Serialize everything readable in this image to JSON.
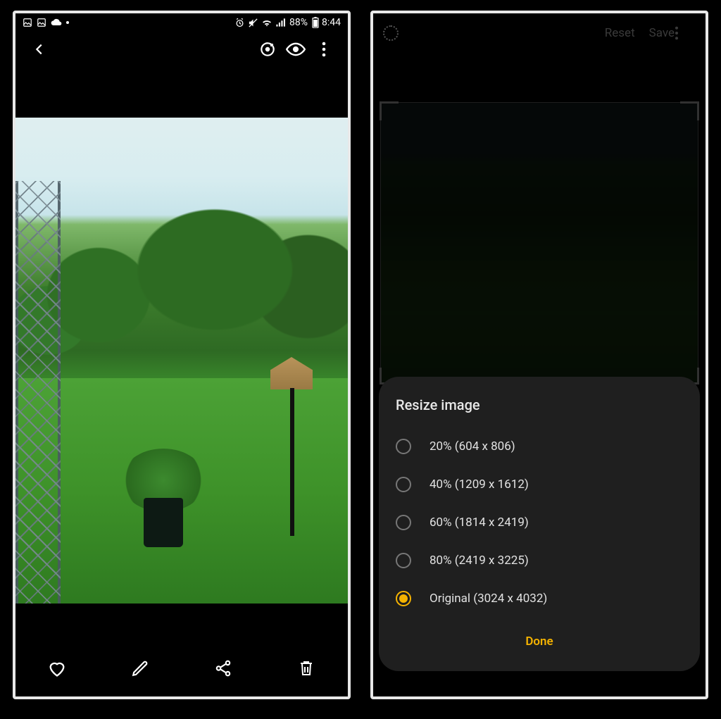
{
  "status": {
    "icons_left": [
      "image-icon",
      "image-icon",
      "cloud-icon",
      "dot-icon"
    ],
    "battery_pct": "88%",
    "time": "8:44"
  },
  "viewer": {
    "actions": {
      "favorite": "Favorite",
      "edit": "Edit",
      "share": "Share",
      "delete": "Delete"
    }
  },
  "editor": {
    "reset": "Reset",
    "save": "Save"
  },
  "resize_sheet": {
    "title": "Resize image",
    "options": [
      {
        "label": "20% (604 x 806)",
        "selected": false
      },
      {
        "label": "40% (1209 x 1612)",
        "selected": false
      },
      {
        "label": "60% (1814 x 2419)",
        "selected": false
      },
      {
        "label": "80% (2419 x 3225)",
        "selected": false
      },
      {
        "label": "Original (3024 x 4032)",
        "selected": true
      }
    ],
    "done": "Done"
  }
}
